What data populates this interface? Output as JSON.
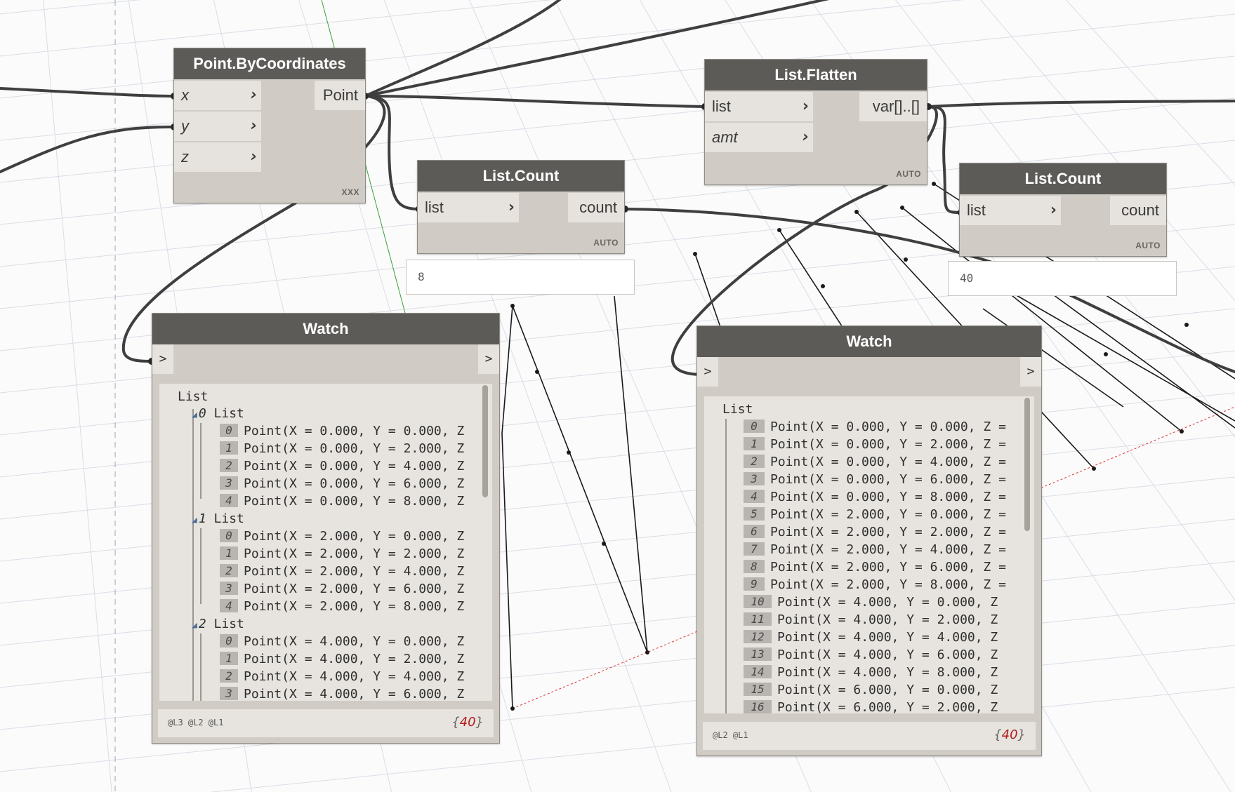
{
  "nodes": {
    "point_by_coordinates": {
      "title": "Point.ByCoordinates",
      "inputs": [
        "x",
        "y",
        "z"
      ],
      "output": "Point",
      "lacing": "XXX"
    },
    "list_count_a": {
      "title": "List.Count",
      "input": "list",
      "output": "count",
      "lacing": "AUTO",
      "preview": "8"
    },
    "list_flatten": {
      "title": "List.Flatten",
      "inputs": [
        "list",
        "amt"
      ],
      "output": "var[]..[]",
      "lacing": "AUTO"
    },
    "list_count_b": {
      "title": "List.Count",
      "input": "list",
      "output": "count",
      "lacing": "AUTO",
      "preview": "40"
    },
    "watch_a": {
      "title": "Watch",
      "in_label": ">",
      "out_label": ">",
      "root": "List",
      "groups": [
        {
          "index": "0",
          "label": "List",
          "items": [
            {
              "i": "0",
              "text": "Point(X = 0.000, Y = 0.000, Z"
            },
            {
              "i": "1",
              "text": "Point(X = 0.000, Y = 2.000, Z"
            },
            {
              "i": "2",
              "text": "Point(X = 0.000, Y = 4.000, Z"
            },
            {
              "i": "3",
              "text": "Point(X = 0.000, Y = 6.000, Z"
            },
            {
              "i": "4",
              "text": "Point(X = 0.000, Y = 8.000, Z"
            }
          ]
        },
        {
          "index": "1",
          "label": "List",
          "items": [
            {
              "i": "0",
              "text": "Point(X = 2.000, Y = 0.000, Z"
            },
            {
              "i": "1",
              "text": "Point(X = 2.000, Y = 2.000, Z"
            },
            {
              "i": "2",
              "text": "Point(X = 2.000, Y = 4.000, Z"
            },
            {
              "i": "3",
              "text": "Point(X = 2.000, Y = 6.000, Z"
            },
            {
              "i": "4",
              "text": "Point(X = 2.000, Y = 8.000, Z"
            }
          ]
        },
        {
          "index": "2",
          "label": "List",
          "items": [
            {
              "i": "0",
              "text": "Point(X = 4.000, Y = 0.000, Z"
            },
            {
              "i": "1",
              "text": "Point(X = 4.000, Y = 2.000, Z"
            },
            {
              "i": "2",
              "text": "Point(X = 4.000, Y = 4.000, Z"
            },
            {
              "i": "3",
              "text": "Point(X = 4.000, Y = 6.000, Z"
            }
          ]
        }
      ],
      "levels": "@L3 @L2 @L1",
      "count": "40"
    },
    "watch_b": {
      "title": "Watch",
      "in_label": ">",
      "out_label": ">",
      "root": "List",
      "items": [
        {
          "i": "0",
          "text": "Point(X = 0.000, Y = 0.000, Z ="
        },
        {
          "i": "1",
          "text": "Point(X = 0.000, Y = 2.000, Z ="
        },
        {
          "i": "2",
          "text": "Point(X = 0.000, Y = 4.000, Z ="
        },
        {
          "i": "3",
          "text": "Point(X = 0.000, Y = 6.000, Z ="
        },
        {
          "i": "4",
          "text": "Point(X = 0.000, Y = 8.000, Z ="
        },
        {
          "i": "5",
          "text": "Point(X = 2.000, Y = 0.000, Z ="
        },
        {
          "i": "6",
          "text": "Point(X = 2.000, Y = 2.000, Z ="
        },
        {
          "i": "7",
          "text": "Point(X = 2.000, Y = 4.000, Z ="
        },
        {
          "i": "8",
          "text": "Point(X = 2.000, Y = 6.000, Z ="
        },
        {
          "i": "9",
          "text": "Point(X = 2.000, Y = 8.000, Z ="
        },
        {
          "i": "10",
          "text": "Point(X = 4.000, Y = 0.000, Z"
        },
        {
          "i": "11",
          "text": "Point(X = 4.000, Y = 2.000, Z"
        },
        {
          "i": "12",
          "text": "Point(X = 4.000, Y = 4.000, Z"
        },
        {
          "i": "13",
          "text": "Point(X = 4.000, Y = 6.000, Z"
        },
        {
          "i": "14",
          "text": "Point(X = 4.000, Y = 8.000, Z"
        },
        {
          "i": "15",
          "text": "Point(X = 6.000, Y = 0.000, Z"
        },
        {
          "i": "16",
          "text": "Point(X = 6.000, Y = 2.000, Z"
        }
      ],
      "levels": "@L2 @L1",
      "count": "40"
    }
  },
  "colors": {
    "node_header": "#5d5b58",
    "node_body": "#d0ccc5",
    "port_bg": "#e6e3de",
    "wire": "#3f3f3f",
    "count_red": "#b31b1b",
    "axis_red": "#e03030",
    "axis_green": "#3aa03a"
  }
}
